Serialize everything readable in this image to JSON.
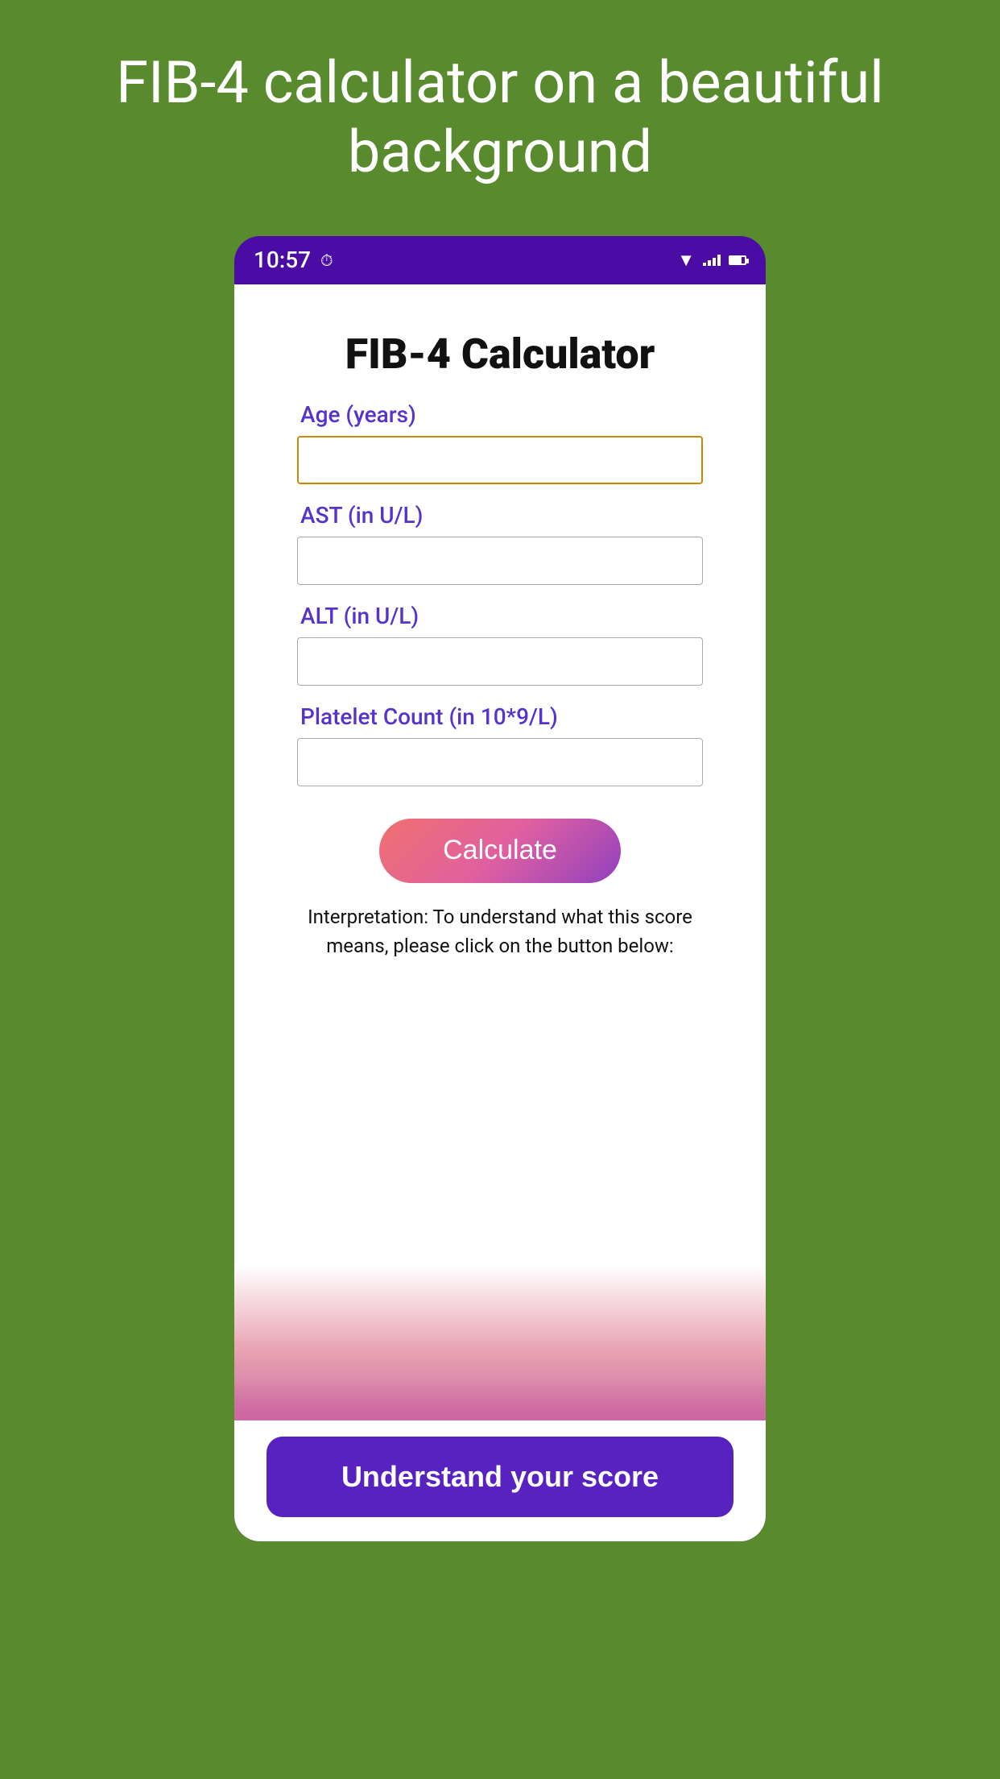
{
  "page": {
    "background_color": "#5a8a2e",
    "title": "FIB-4 calculator on a beautiful background"
  },
  "status_bar": {
    "time": "10:57",
    "background_color": "#4a0ca4"
  },
  "app": {
    "title": "FIB-4 Calculator",
    "fields": [
      {
        "id": "age",
        "label": "Age (years)",
        "placeholder": "",
        "focused": true
      },
      {
        "id": "ast",
        "label": "AST (in U/L)",
        "placeholder": "",
        "focused": false
      },
      {
        "id": "alt",
        "label": "ALT (in U/L)",
        "placeholder": "",
        "focused": false
      },
      {
        "id": "platelet",
        "label": "Platelet Count (in 10*9/L)",
        "placeholder": "",
        "focused": false
      }
    ],
    "calculate_button_label": "Calculate",
    "interpretation_text": "Interpretation: To understand what this score means, please click on the button below:",
    "understand_button_label": "Understand your score"
  }
}
